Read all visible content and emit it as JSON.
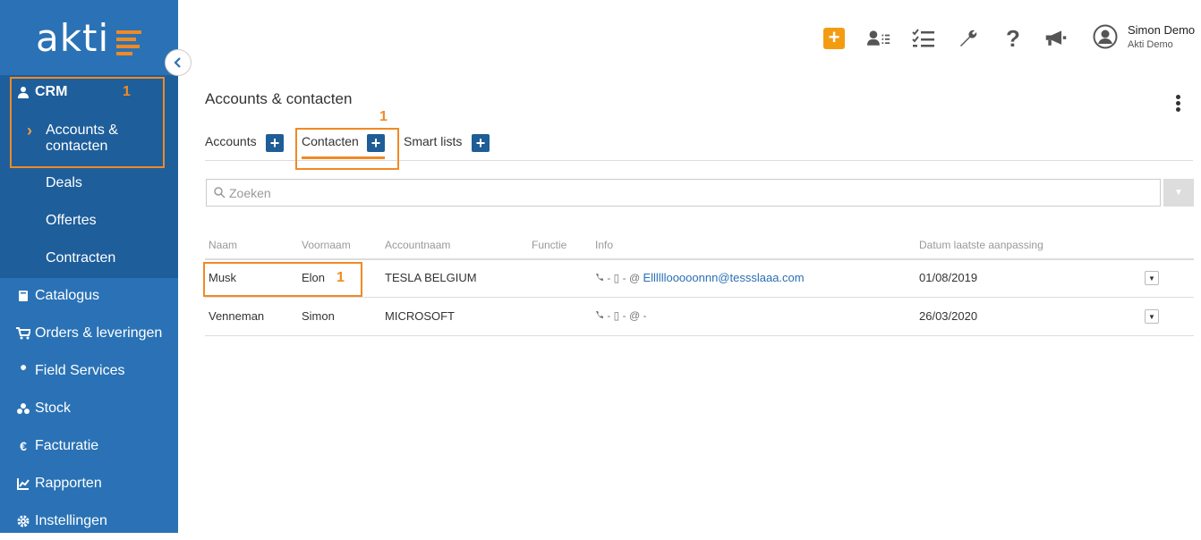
{
  "app": {
    "logo": "akti",
    "accent_color": "#f08a24",
    "sidebar_color": "#2a72b5"
  },
  "sidebar": {
    "crm_label": "CRM",
    "crm_sub": [
      {
        "label": "Accounts &",
        "label2": "contacten",
        "active": true
      },
      {
        "label": "Deals"
      },
      {
        "label": "Offertes"
      },
      {
        "label": "Contracten"
      }
    ],
    "items": [
      {
        "label": "Catalogus",
        "icon": "book-icon"
      },
      {
        "label": "Orders & leveringen",
        "icon": "cart-icon"
      },
      {
        "label": "Field Services",
        "icon": "wrench-icon"
      },
      {
        "label": "Stock",
        "icon": "boxes-icon"
      },
      {
        "label": "Facturatie",
        "icon": "euro-icon"
      },
      {
        "label": "Rapporten",
        "icon": "chart-icon"
      },
      {
        "label": "Instellingen",
        "icon": "gear-icon"
      }
    ]
  },
  "annotations": {
    "marker_sidebar": "1",
    "marker_tab": "1",
    "marker_row": "1"
  },
  "topbar": {
    "user_name": "Simon Demo",
    "user_company": "Akti Demo"
  },
  "main": {
    "title": "Accounts & contacten",
    "tabs": [
      {
        "label": "Accounts"
      },
      {
        "label": "Contacten",
        "active": true
      },
      {
        "label": "Smart lists"
      }
    ],
    "search_placeholder": "Zoeken"
  },
  "table": {
    "columns": [
      "Naam",
      "Voornaam",
      "Accountnaam",
      "Functie",
      "Info",
      "Datum laatste aanpassing"
    ],
    "rows": [
      {
        "naam": "Musk",
        "voornaam": "Elon",
        "account": "TESLA BELGIUM",
        "functie": "",
        "info_prefix": "- ▯ - @",
        "email": "Ellllllooooonnn@tessslaaa.com",
        "datum": "01/08/2019"
      },
      {
        "naam": "Venneman",
        "voornaam": "Simon",
        "account": "MICROSOFT",
        "functie": "",
        "info_prefix": "- ▯ - @ -",
        "email": "",
        "datum": "26/03/2020"
      }
    ]
  }
}
